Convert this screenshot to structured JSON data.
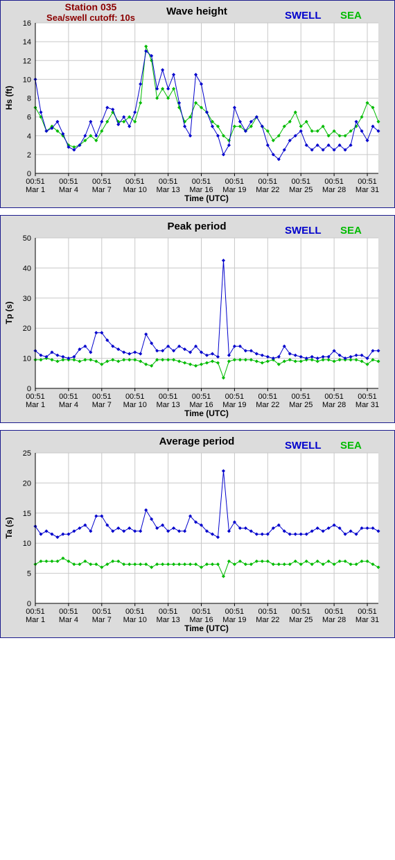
{
  "station": {
    "name": "Station 035",
    "cutoff": "Sea/swell cutoff: 10s"
  },
  "legend": {
    "swell": "SWELL",
    "sea": "SEA"
  },
  "colors": {
    "swell": "#0000cc",
    "sea": "#00bb00",
    "station": "#8b0000",
    "frame": "#1a1a8c"
  },
  "x_axis": {
    "xlabel": "Time (UTC)",
    "ticks": [
      {
        "day": 1,
        "time": "00:51",
        "date": "Mar 1"
      },
      {
        "day": 4,
        "time": "00:51",
        "date": "Mar 4"
      },
      {
        "day": 7,
        "time": "00:51",
        "date": "Mar 7"
      },
      {
        "day": 10,
        "time": "00:51",
        "date": "Mar 10"
      },
      {
        "day": 13,
        "time": "00:51",
        "date": "Mar 13"
      },
      {
        "day": 16,
        "time": "00:51",
        "date": "Mar 16"
      },
      {
        "day": 19,
        "time": "00:51",
        "date": "Mar 19"
      },
      {
        "day": 22,
        "time": "00:51",
        "date": "Mar 22"
      },
      {
        "day": 25,
        "time": "00:51",
        "date": "Mar 25"
      },
      {
        "day": 28,
        "time": "00:51",
        "date": "Mar 28"
      },
      {
        "day": 31,
        "time": "00:51",
        "date": "Mar 31"
      }
    ]
  },
  "chart_data": [
    {
      "type": "line",
      "title": "Wave height",
      "ylabel": "Hs (ft)",
      "xlabel": "Time (UTC)",
      "xlim": [
        1,
        32
      ],
      "ylim": [
        0,
        16
      ],
      "yticks": [
        0,
        2,
        4,
        6,
        8,
        10,
        12,
        14,
        16
      ],
      "grid": true,
      "legend": "top-right",
      "x": [
        1.0,
        1.5,
        2.0,
        2.5,
        3.0,
        3.5,
        4.0,
        4.5,
        5.0,
        5.5,
        6.0,
        6.5,
        7.0,
        7.5,
        8.0,
        8.5,
        9.0,
        9.5,
        10.0,
        10.5,
        11.0,
        11.5,
        12.0,
        12.5,
        13.0,
        13.5,
        14.0,
        14.5,
        15.0,
        15.5,
        16.0,
        16.5,
        17.0,
        17.5,
        18.0,
        18.5,
        19.0,
        19.5,
        20.0,
        20.5,
        21.0,
        21.5,
        22.0,
        22.5,
        23.0,
        23.5,
        24.0,
        24.5,
        25.0,
        25.5,
        26.0,
        26.5,
        27.0,
        27.5,
        28.0,
        28.5,
        29.0,
        29.5,
        30.0,
        30.5,
        31.0,
        31.5,
        32.0
      ],
      "series": [
        {
          "name": "SWELL",
          "values": [
            10.0,
            6.5,
            4.5,
            4.8,
            5.5,
            4.2,
            2.8,
            2.5,
            3.0,
            4.0,
            5.5,
            4.0,
            5.5,
            7.0,
            6.8,
            5.2,
            6.0,
            5.0,
            6.5,
            9.5,
            13.0,
            12.5,
            9.0,
            11.0,
            9.0,
            10.5,
            7.5,
            5.0,
            4.0,
            10.5,
            9.5,
            6.5,
            5.0,
            4.0,
            2.0,
            3.0,
            7.0,
            5.5,
            4.5,
            5.5,
            6.0,
            5.0,
            3.0,
            2.0,
            1.5,
            2.5,
            3.5,
            4.0,
            4.5,
            3.0,
            2.5,
            3.0,
            2.5,
            3.0,
            2.5,
            3.0,
            2.5,
            3.0,
            5.5,
            4.5,
            3.5,
            5.0,
            4.5
          ]
        },
        {
          "name": "SEA",
          "values": [
            7.0,
            6.0,
            4.5,
            5.0,
            4.5,
            4.0,
            3.0,
            2.8,
            3.0,
            3.5,
            4.0,
            3.5,
            4.5,
            5.5,
            6.5,
            5.5,
            5.5,
            6.0,
            5.5,
            7.5,
            13.5,
            12.0,
            8.0,
            9.0,
            8.0,
            9.0,
            7.0,
            5.5,
            6.0,
            7.5,
            7.0,
            6.5,
            5.5,
            5.0,
            4.0,
            3.5,
            5.0,
            5.0,
            4.5,
            5.0,
            6.0,
            5.0,
            4.5,
            3.5,
            4.0,
            5.0,
            5.5,
            6.5,
            5.0,
            5.5,
            4.5,
            4.5,
            5.0,
            4.0,
            4.5,
            4.0,
            4.0,
            4.5,
            5.0,
            6.0,
            7.5,
            7.0,
            5.5
          ]
        }
      ]
    },
    {
      "type": "line",
      "title": "Peak period",
      "ylabel": "Tp (s)",
      "xlabel": "Time (UTC)",
      "xlim": [
        1,
        32
      ],
      "ylim": [
        0,
        50
      ],
      "yticks": [
        0,
        10,
        20,
        30,
        40,
        50
      ],
      "grid": true,
      "legend": "top-right",
      "x": [
        1.0,
        1.5,
        2.0,
        2.5,
        3.0,
        3.5,
        4.0,
        4.5,
        5.0,
        5.5,
        6.0,
        6.5,
        7.0,
        7.5,
        8.0,
        8.5,
        9.0,
        9.5,
        10.0,
        10.5,
        11.0,
        11.5,
        12.0,
        12.5,
        13.0,
        13.5,
        14.0,
        14.5,
        15.0,
        15.5,
        16.0,
        16.5,
        17.0,
        17.5,
        18.0,
        18.5,
        19.0,
        19.5,
        20.0,
        20.5,
        21.0,
        21.5,
        22.0,
        22.5,
        23.0,
        23.5,
        24.0,
        24.5,
        25.0,
        25.5,
        26.0,
        26.5,
        27.0,
        27.5,
        28.0,
        28.5,
        29.0,
        29.5,
        30.0,
        30.5,
        31.0,
        31.5,
        32.0
      ],
      "series": [
        {
          "name": "SWELL",
          "values": [
            12.5,
            11.0,
            10.5,
            12.0,
            11.0,
            10.5,
            10.0,
            10.5,
            13.0,
            14.0,
            12.0,
            18.5,
            18.5,
            16.0,
            14.0,
            13.0,
            12.0,
            11.5,
            12.0,
            11.5,
            18.0,
            15.0,
            12.5,
            12.5,
            14.0,
            12.5,
            14.0,
            13.0,
            12.0,
            14.0,
            12.0,
            11.0,
            11.5,
            10.5,
            42.5,
            11.0,
            14.0,
            14.0,
            12.5,
            12.5,
            11.5,
            11.0,
            10.5,
            10.0,
            10.5,
            14.0,
            11.5,
            11.0,
            10.5,
            10.0,
            10.5,
            10.0,
            10.5,
            10.5,
            12.5,
            11.0,
            10.0,
            10.5,
            11.0,
            11.0,
            10.0,
            12.5,
            12.5
          ]
        },
        {
          "name": "SEA",
          "values": [
            9.5,
            9.5,
            10.0,
            9.5,
            9.0,
            9.5,
            9.5,
            9.5,
            9.0,
            9.5,
            9.5,
            9.0,
            8.0,
            9.0,
            9.5,
            9.0,
            9.5,
            9.5,
            9.5,
            9.0,
            8.0,
            7.5,
            9.5,
            9.5,
            9.5,
            9.5,
            9.0,
            8.5,
            8.0,
            7.5,
            8.0,
            8.5,
            9.0,
            8.5,
            3.5,
            9.0,
            9.5,
            9.5,
            9.5,
            9.5,
            9.0,
            8.5,
            9.0,
            9.5,
            8.0,
            9.0,
            9.5,
            9.0,
            9.0,
            9.5,
            9.5,
            9.0,
            9.5,
            9.5,
            9.0,
            9.5,
            9.5,
            9.5,
            9.5,
            9.0,
            8.0,
            9.5,
            9.0
          ]
        }
      ]
    },
    {
      "type": "line",
      "title": "Average period",
      "ylabel": "Ta (s)",
      "xlabel": "Time (UTC)",
      "xlim": [
        1,
        32
      ],
      "ylim": [
        0,
        25
      ],
      "yticks": [
        0,
        5,
        10,
        15,
        20,
        25
      ],
      "grid": true,
      "legend": "top-right",
      "x": [
        1.0,
        1.5,
        2.0,
        2.5,
        3.0,
        3.5,
        4.0,
        4.5,
        5.0,
        5.5,
        6.0,
        6.5,
        7.0,
        7.5,
        8.0,
        8.5,
        9.0,
        9.5,
        10.0,
        10.5,
        11.0,
        11.5,
        12.0,
        12.5,
        13.0,
        13.5,
        14.0,
        14.5,
        15.0,
        15.5,
        16.0,
        16.5,
        17.0,
        17.5,
        18.0,
        18.5,
        19.0,
        19.5,
        20.0,
        20.5,
        21.0,
        21.5,
        22.0,
        22.5,
        23.0,
        23.5,
        24.0,
        24.5,
        25.0,
        25.5,
        26.0,
        26.5,
        27.0,
        27.5,
        28.0,
        28.5,
        29.0,
        29.5,
        30.0,
        30.5,
        31.0,
        31.5,
        32.0
      ],
      "series": [
        {
          "name": "SWELL",
          "values": [
            12.8,
            11.5,
            12.0,
            11.5,
            11.0,
            11.5,
            11.5,
            12.0,
            12.5,
            13.0,
            12.0,
            14.5,
            14.5,
            13.0,
            12.0,
            12.5,
            12.0,
            12.5,
            12.0,
            12.0,
            15.5,
            14.0,
            12.5,
            13.0,
            12.0,
            12.5,
            12.0,
            12.0,
            14.5,
            13.5,
            13.0,
            12.0,
            11.5,
            11.0,
            22.0,
            12.0,
            13.5,
            12.5,
            12.5,
            12.0,
            11.5,
            11.5,
            11.5,
            12.5,
            13.0,
            12.0,
            11.5,
            11.5,
            11.5,
            11.5,
            12.0,
            12.5,
            12.0,
            12.5,
            13.0,
            12.5,
            11.5,
            12.0,
            11.5,
            12.5,
            12.5,
            12.5,
            12.0
          ]
        },
        {
          "name": "SEA",
          "values": [
            6.5,
            7.0,
            7.0,
            7.0,
            7.0,
            7.5,
            7.0,
            6.5,
            6.5,
            7.0,
            6.5,
            6.5,
            6.0,
            6.5,
            7.0,
            7.0,
            6.5,
            6.5,
            6.5,
            6.5,
            6.5,
            6.0,
            6.5,
            6.5,
            6.5,
            6.5,
            6.5,
            6.5,
            6.5,
            6.5,
            6.0,
            6.5,
            6.5,
            6.5,
            4.5,
            7.0,
            6.5,
            7.0,
            6.5,
            6.5,
            7.0,
            7.0,
            7.0,
            6.5,
            6.5,
            6.5,
            6.5,
            7.0,
            6.5,
            7.0,
            6.5,
            7.0,
            6.5,
            7.0,
            6.5,
            7.0,
            7.0,
            6.5,
            6.5,
            7.0,
            7.0,
            6.5,
            6.0
          ]
        }
      ]
    }
  ]
}
